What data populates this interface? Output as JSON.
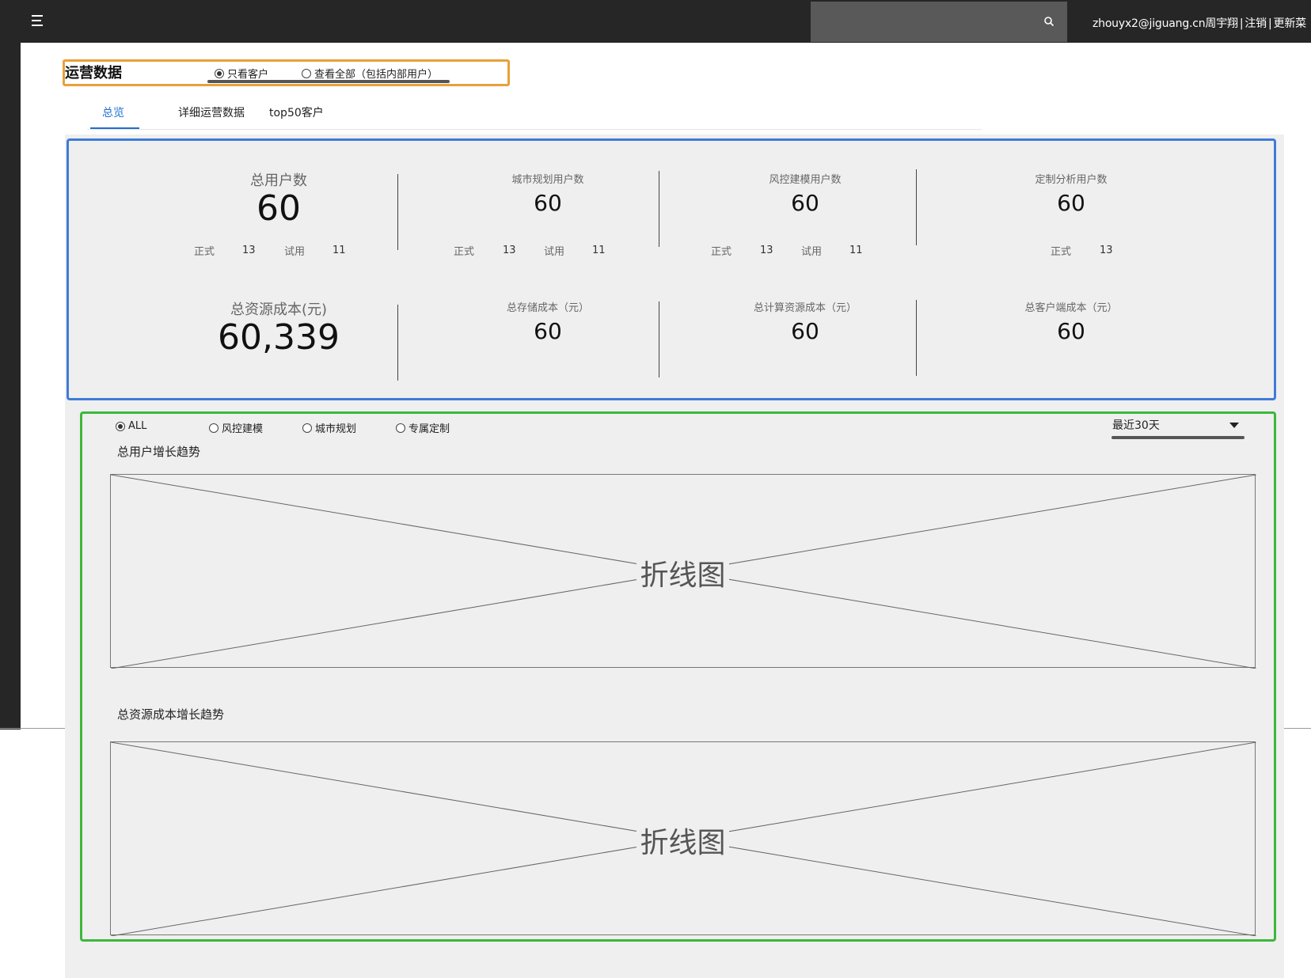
{
  "header": {
    "user": "zhouyx2@jiguang.cn周宇翔",
    "logout": "注销",
    "update": "更新菜"
  },
  "page": {
    "title": "运营数据",
    "scope_options": [
      {
        "label": "只看客户",
        "checked": true
      },
      {
        "label": "查看全部（包括内部用户）",
        "checked": false
      }
    ]
  },
  "tabs": [
    {
      "label": "总览",
      "active": true
    },
    {
      "label": "详细运营数据",
      "active": false
    },
    {
      "label": "top50客户",
      "active": false
    }
  ],
  "stats": {
    "total_users": {
      "label": "总用户数",
      "value": "60",
      "formal_label": "正式",
      "formal": "13",
      "trial_label": "试用",
      "trial": "11"
    },
    "city_users": {
      "label": "城市规划用户数",
      "value": "60",
      "formal_label": "正式",
      "formal": "13",
      "trial_label": "试用",
      "trial": "11"
    },
    "risk_users": {
      "label": "风控建模用户数",
      "value": "60",
      "formal_label": "正式",
      "formal": "13",
      "trial_label": "试用",
      "trial": "11"
    },
    "custom_users": {
      "label": "定制分析用户数",
      "value": "60",
      "formal_label": "正式",
      "formal": "13"
    },
    "total_cost": {
      "label": "总资源成本(元)",
      "value": "60,339"
    },
    "storage_cost": {
      "label": "总存储成本（元）",
      "value": "60"
    },
    "compute_cost": {
      "label": "总计算资源成本（元）",
      "value": "60"
    },
    "client_cost": {
      "label": "总客户端成本（元）",
      "value": "60"
    }
  },
  "filters": [
    {
      "label": "ALL",
      "checked": true
    },
    {
      "label": "风控建模",
      "checked": false
    },
    {
      "label": "城市规划",
      "checked": false
    },
    {
      "label": "专属定制",
      "checked": false
    }
  ],
  "range_select": {
    "value": "最近30天"
  },
  "charts": [
    {
      "title": "总用户增长趋势",
      "placeholder": "折线图"
    },
    {
      "title": "总资源成本增长趋势",
      "placeholder": "折线图"
    }
  ]
}
